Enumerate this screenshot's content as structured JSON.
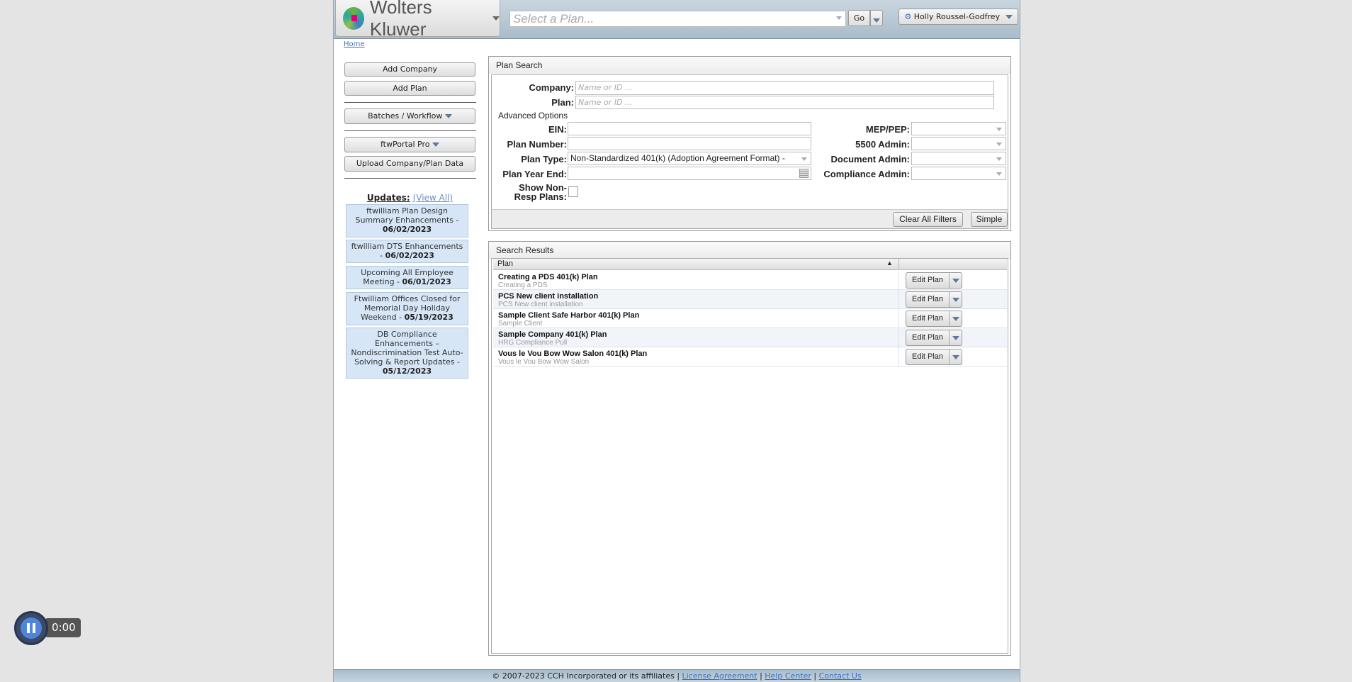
{
  "header": {
    "brand": "Wolters Kluwer",
    "plan_select_placeholder": "Select a Plan...",
    "go_label": "Go",
    "user_name": "Holly Roussel-Godfrey"
  },
  "breadcrumb": {
    "home": "Home"
  },
  "sidebar": {
    "buttons": [
      "Add Company",
      "Add Plan",
      "Batches / Workflow",
      "ftwPortal Pro",
      "Upload Company/Plan Data"
    ],
    "updates_label": "Updates:",
    "view_all": "(View All)",
    "updates": [
      {
        "text": "ftwilliam Plan Design Summary Enhancements -",
        "date": "06/02/2023"
      },
      {
        "text": "ftwilliam DTS Enhancements -",
        "date": "06/02/2023"
      },
      {
        "text": "Upcoming All Employee Meeting -",
        "date": "06/01/2023"
      },
      {
        "text": "Ftwilliam Offices Closed for Memorial Day Holiday Weekend -",
        "date": "05/19/2023"
      },
      {
        "text": "DB Compliance Enhancements – Nondiscrimination Test Auto-Solving & Report Updates -",
        "date": "05/12/2023"
      }
    ]
  },
  "plan_search": {
    "title": "Plan Search",
    "company_label": "Company:",
    "plan_label": "Plan:",
    "placeholder": "Name or ID ...",
    "advanced": "Advanced Options",
    "ein_label": "EIN:",
    "plan_number_label": "Plan Number:",
    "plan_type_label": "Plan Type:",
    "plan_type_value": "Non-Standardized 401(k) (Adoption Agreement Format) -",
    "plan_year_end_label": "Plan Year End:",
    "show_non_resp_label": "Show Non-Resp Plans:",
    "mep_label": "MEP/PEP:",
    "admin5500_label": "5500 Admin:",
    "doc_admin_label": "Document Admin:",
    "comp_admin_label": "Compliance Admin:",
    "clear_label": "Clear All Filters",
    "simple_label": "Simple"
  },
  "results": {
    "title": "Search Results",
    "col_plan": "Plan",
    "edit_label": "Edit Plan",
    "rows": [
      {
        "title": "Creating a PDS 401(k) Plan",
        "sub": "Creating a PDS"
      },
      {
        "title": "PCS New client installation",
        "sub": "PCS New client installation"
      },
      {
        "title": "Sample Client Safe Harbor 401(k) Plan",
        "sub": "Sample Client"
      },
      {
        "title": "Sample Company 401(k) Plan",
        "sub": "HRG Compliance Pull"
      },
      {
        "title": "Vous le Vou Bow Wow Salon 401(k) Plan",
        "sub": "Vous le Vou Bow Wow Salon"
      }
    ]
  },
  "footer": {
    "copyright": "© 2007-2023 CCH Incorporated or its affiliates",
    "license": "License Agreement",
    "help": "Help Center",
    "contact": "Contact Us"
  },
  "video": {
    "time": "0:00"
  }
}
